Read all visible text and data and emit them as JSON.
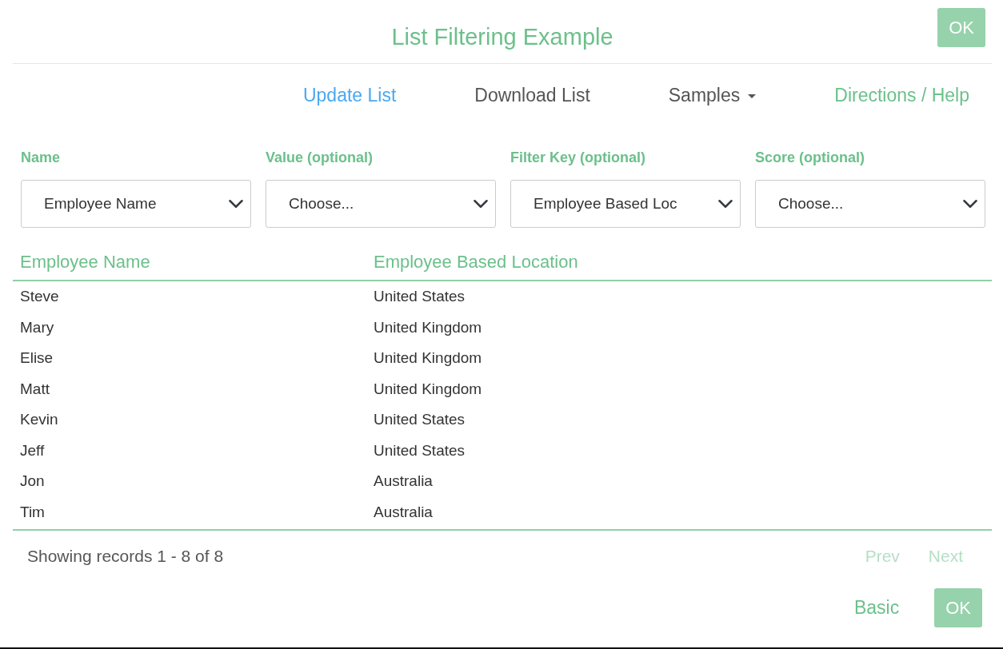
{
  "window": {
    "title": "List Filtering Example",
    "ok_button": "OK"
  },
  "nav": [
    {
      "label": "Update List",
      "kind": "primary"
    },
    {
      "label": "Download List",
      "kind": "plain"
    },
    {
      "label": "Samples",
      "kind": "dropdown"
    },
    {
      "label": "Directions / Help",
      "kind": "help"
    }
  ],
  "filters": [
    {
      "label": "Name",
      "value": "Employee Name"
    },
    {
      "label": "Value (optional)",
      "value": "Choose..."
    },
    {
      "label": "Filter Key (optional)",
      "value": "Employee Based Loc"
    },
    {
      "label": "Score (optional)",
      "value": "Choose..."
    }
  ],
  "table": {
    "columns": [
      "Employee Name",
      "Employee Based Location"
    ],
    "rows": [
      [
        "Steve",
        "United States"
      ],
      [
        "Mary",
        "United Kingdom"
      ],
      [
        "Elise",
        "United Kingdom"
      ],
      [
        "Matt",
        "United Kingdom"
      ],
      [
        "Kevin",
        "United States"
      ],
      [
        "Jeff",
        "United States"
      ],
      [
        "Jon",
        "Australia"
      ],
      [
        "Tim",
        "Australia"
      ]
    ]
  },
  "pagination": {
    "summary": "Showing records 1 - 8 of 8",
    "buttons": [
      {
        "label": "Prev",
        "disabled": true
      },
      {
        "label": "Next",
        "disabled": true
      }
    ]
  },
  "footer": {
    "buttons": [
      {
        "label": "Basic",
        "kind": "link"
      },
      {
        "label": "OK",
        "kind": "primary"
      }
    ]
  }
}
